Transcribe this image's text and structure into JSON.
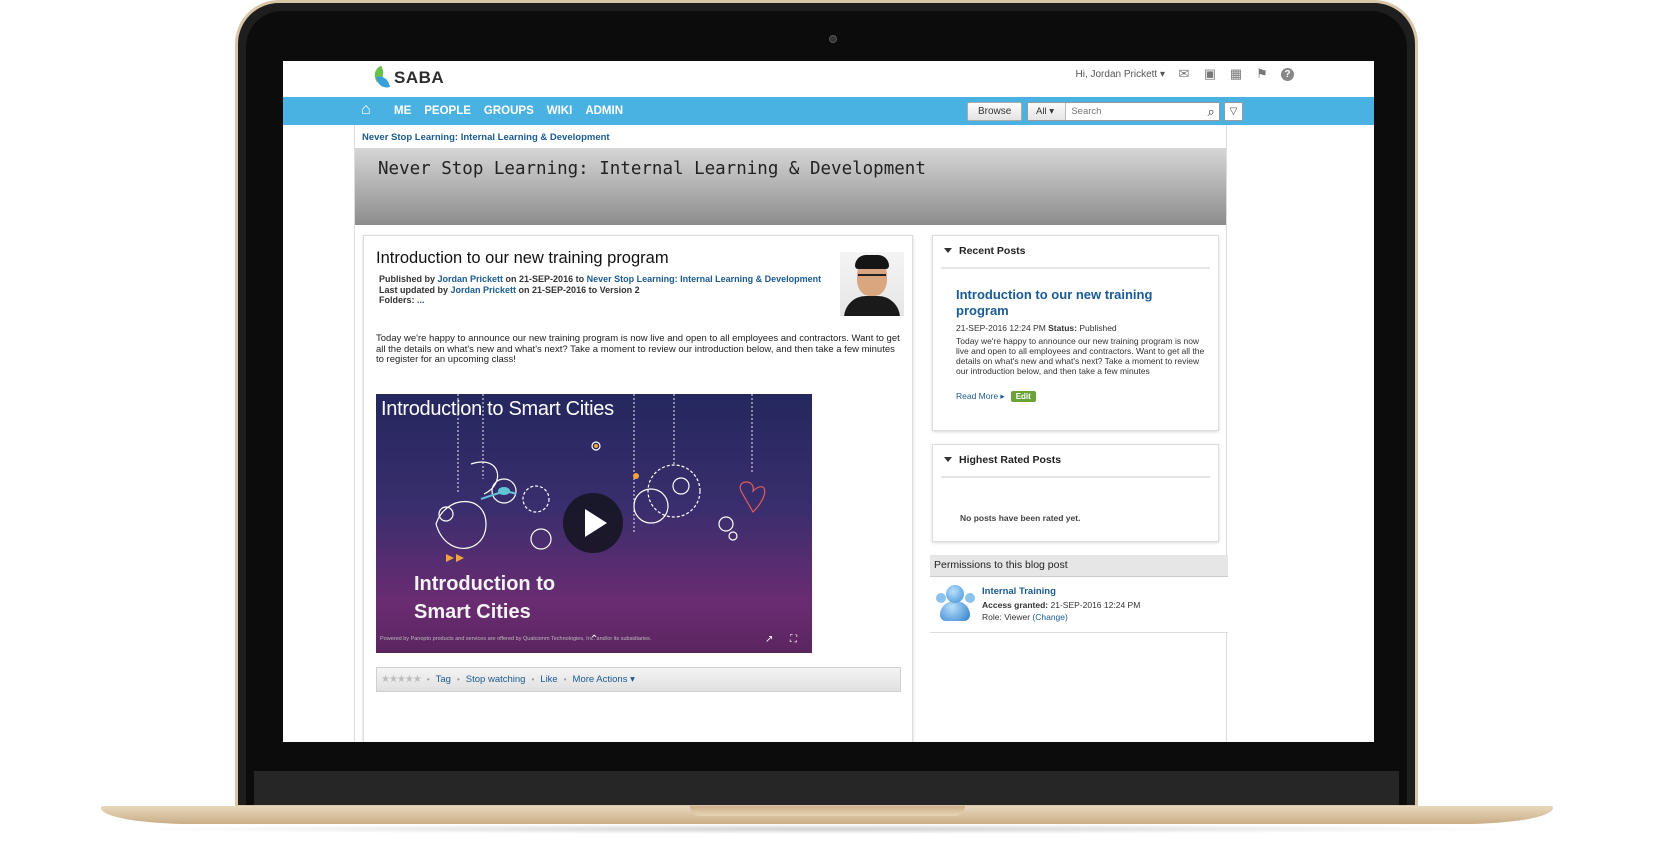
{
  "app": {
    "logo_text": "SABA",
    "user_greeting": "Hi, Jordan Prickett ▾",
    "help_label": "?"
  },
  "nav": {
    "items": [
      {
        "label": "ME"
      },
      {
        "label": "PEOPLE"
      },
      {
        "label": "GROUPS"
      },
      {
        "label": "WIKI"
      },
      {
        "label": "ADMIN"
      }
    ],
    "browse_label": "Browse",
    "search_scope": "All",
    "search_placeholder": "Search"
  },
  "page": {
    "breadcrumb": "Never Stop Learning: Internal Learning & Development",
    "banner_title": "Never Stop Learning: Internal Learning & Development"
  },
  "post": {
    "title": "Introduction to our new training program",
    "published_prefix": "Published by ",
    "author": "Jordan Prickett",
    "published_on": " on 21-SEP-2016 to ",
    "blog_name": "Never Stop Learning: Internal Learning & Development",
    "updated_prefix": "Last updated by ",
    "updated_author": "Jordan Prickett",
    "updated_on": " on 21-SEP-2016 to Version 2",
    "folders_label": "Folders: ",
    "folders_value": "...",
    "body": "Today we're happy to announce our new training program is now live and open to all employees and contractors. Want to get all the details on what's new and what's next? Take a moment to review our introduction below, and then take a few minutes to register for an upcoming class!",
    "video": {
      "title": "Introduction to Smart Cities",
      "caption_line1": "Introduction to",
      "caption_line2": "Smart Cities",
      "footer": "Powered by Panopto  products and services are offered by Qualcomm Technologies, Inc. and/or its subsidiaries."
    },
    "actions": {
      "stars": "★★★★★",
      "tag": "Tag",
      "stop_watching": "Stop watching",
      "like": "Like",
      "more_actions": "More Actions ▾"
    }
  },
  "recent_posts": {
    "heading": "Recent Posts",
    "item": {
      "title": "Introduction to our new training program",
      "date": "21-SEP-2016 12:24 PM ",
      "status_label": "Status:",
      "status_value": " Published",
      "excerpt": "Today we're happy to announce our new training program is now live and open to all employees and contractors. Want to get all the details on what's new and what's next? Take a moment to review our introduction below, and then take a few minutes",
      "read_more": "Read More ▸",
      "edit": "Edit"
    }
  },
  "highest_rated": {
    "heading": "Highest Rated Posts",
    "empty_text": "No posts have been rated yet."
  },
  "permissions": {
    "heading": "Permissions to this blog post",
    "name": "Internal Training",
    "access_label": "Access granted:",
    "access_value": " 21-SEP-2016 12:24 PM",
    "role_prefix": "Role: Viewer ",
    "change": "(Change)"
  }
}
